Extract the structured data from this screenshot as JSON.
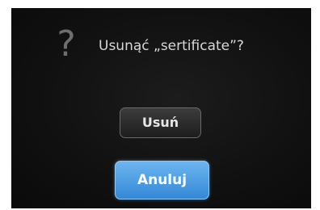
{
  "dialog": {
    "icon": "question-icon",
    "icon_glyph": "?",
    "message": "Usunąć „sertificate”?",
    "delete_label": "Usuń",
    "cancel_label": "Anuluj"
  },
  "colors": {
    "background": "#111111",
    "text": "#d8d8d8",
    "icon": "#6e6e6e",
    "primary_button": "#3f93dc",
    "secondary_button": "#2a2a2a"
  }
}
